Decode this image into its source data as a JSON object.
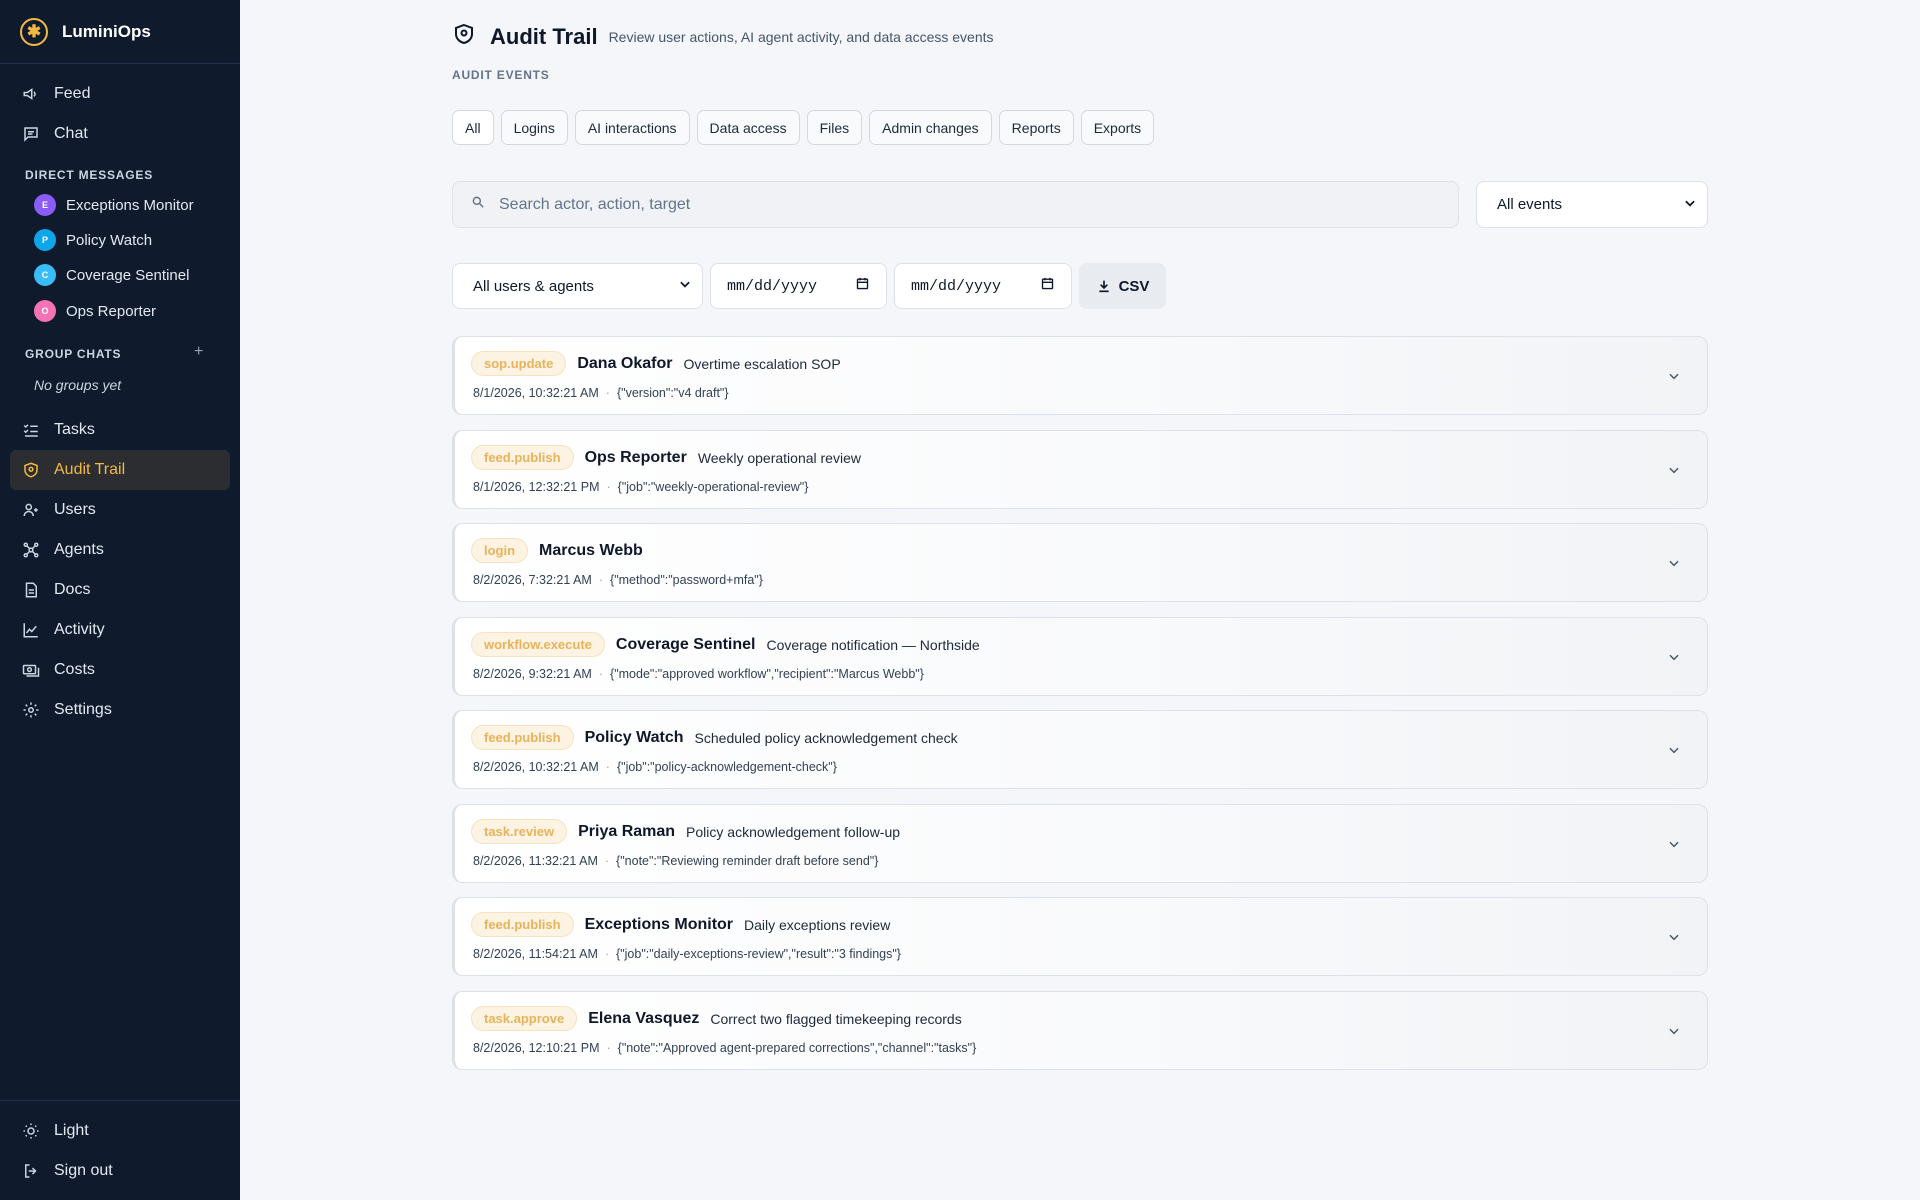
{
  "app": {
    "name": "LuminiOps",
    "logo_glyph": "✱"
  },
  "sidebar": {
    "nav_top": [
      {
        "label": "Feed",
        "icon": "megaphone-icon"
      },
      {
        "label": "Chat",
        "icon": "chat-icon"
      }
    ],
    "direct_messages_label": "DIRECT MESSAGES",
    "direct_messages": [
      {
        "name": "Exceptions Monitor",
        "initial": "E",
        "color": "#8b5cf6"
      },
      {
        "name": "Policy Watch",
        "initial": "P",
        "color": "#0ea5e9"
      },
      {
        "name": "Coverage Sentinel",
        "initial": "C",
        "color": "#38bdf8"
      },
      {
        "name": "Ops Reporter",
        "initial": "O",
        "color": "#f472b6"
      }
    ],
    "group_chats_label": "GROUP CHATS",
    "no_groups": "No groups yet",
    "nav_main": [
      {
        "label": "Tasks",
        "icon": "tasks-icon"
      },
      {
        "label": "Audit Trail",
        "icon": "shield-icon",
        "active": true
      },
      {
        "label": "Users",
        "icon": "users-icon"
      },
      {
        "label": "Agents",
        "icon": "agents-icon"
      },
      {
        "label": "Docs",
        "icon": "document-icon"
      },
      {
        "label": "Activity",
        "icon": "activity-icon"
      },
      {
        "label": "Costs",
        "icon": "money-icon"
      },
      {
        "label": "Settings",
        "icon": "gear-icon"
      }
    ],
    "nav_bottom": [
      {
        "label": "Light",
        "icon": "sun-icon"
      },
      {
        "label": "Sign out",
        "icon": "sign-out-icon"
      }
    ],
    "accent_color": "#f5b942"
  },
  "header": {
    "title": "Audit Trail",
    "subtitle": "Review user actions, AI agent activity, and data access events"
  },
  "filters": {
    "section_label": "AUDIT EVENTS",
    "tabs": [
      "All",
      "Logins",
      "AI interactions",
      "Data access",
      "Files",
      "Admin changes",
      "Reports",
      "Exports"
    ],
    "active_tab": "All",
    "search_placeholder": "Search actor, action, target",
    "event_type": "All events",
    "actor_filter": "All users & agents",
    "date_from": "mm/dd/yyyy",
    "date_to": "mm/dd/yyyy",
    "export_label": "CSV"
  },
  "events": [
    {
      "action": "sop.update",
      "actor": "Dana Okafor",
      "target": "Overtime escalation SOP",
      "time": "8/1/2026, 10:32:21 AM",
      "details": "{\"version\":\"v4 draft\"}"
    },
    {
      "action": "feed.publish",
      "actor": "Ops Reporter",
      "target": "Weekly operational review",
      "time": "8/1/2026, 12:32:21 PM",
      "details": "{\"job\":\"weekly-operational-review\"}"
    },
    {
      "action": "login",
      "actor": "Marcus Webb",
      "target": "",
      "time": "8/2/2026, 7:32:21 AM",
      "details": "{\"method\":\"password+mfa\"}"
    },
    {
      "action": "workflow.execute",
      "actor": "Coverage Sentinel",
      "target": "Coverage notification — Northside",
      "time": "8/2/2026, 9:32:21 AM",
      "details": "{\"mode\":\"approved workflow\",\"recipient\":\"Marcus Webb\"}"
    },
    {
      "action": "feed.publish",
      "actor": "Policy Watch",
      "target": "Scheduled policy acknowledgement check",
      "time": "8/2/2026, 10:32:21 AM",
      "details": "{\"job\":\"policy-acknowledgement-check\"}"
    },
    {
      "action": "task.review",
      "actor": "Priya Raman",
      "target": "Policy acknowledgement follow-up",
      "time": "8/2/2026, 11:32:21 AM",
      "details": "{\"note\":\"Reviewing reminder draft before send\"}"
    },
    {
      "action": "feed.publish",
      "actor": "Exceptions Monitor",
      "target": "Daily exceptions review",
      "time": "8/2/2026, 11:54:21 AM",
      "details": "{\"job\":\"daily-exceptions-review\",\"result\":\"3 findings\"}"
    },
    {
      "action": "task.approve",
      "actor": "Elena Vasquez",
      "target": "Correct two flagged timekeeping records",
      "time": "8/2/2026, 12:10:21 PM",
      "details": "{\"note\":\"Approved agent-prepared corrections\",\"channel\":\"tasks\"}"
    }
  ]
}
